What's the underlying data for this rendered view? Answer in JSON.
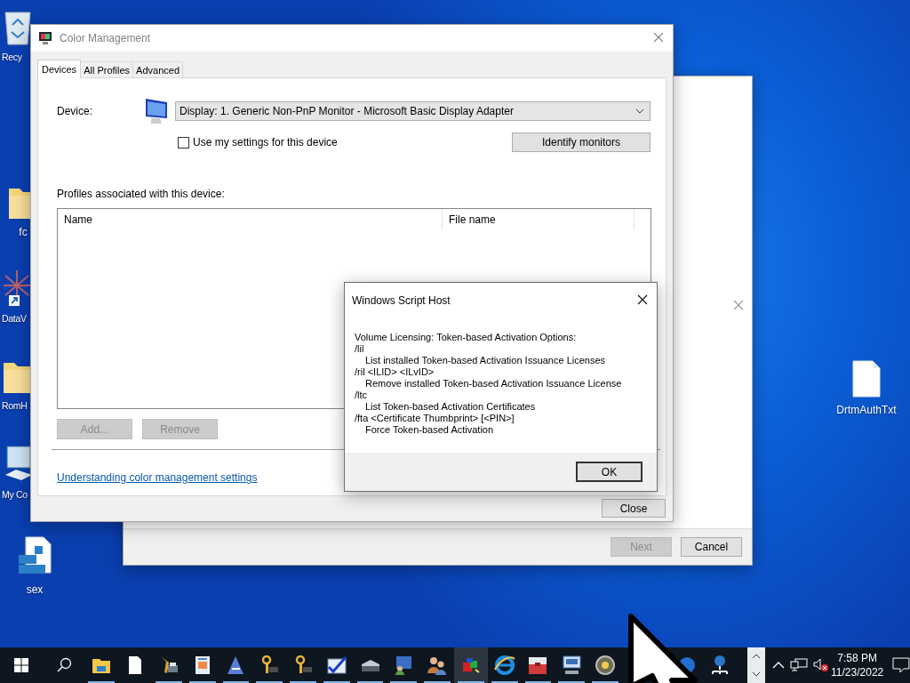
{
  "desktop_icons": [
    {
      "label": "Recy"
    },
    {
      "label": "fc"
    },
    {
      "label": "DataV"
    },
    {
      "label": "RomH"
    },
    {
      "label": "My Co"
    },
    {
      "label": "sex"
    },
    {
      "label": "DrtmAuthTxt"
    }
  ],
  "wizard_window": {
    "next_button": {
      "label": "Next",
      "disabled": true
    },
    "cancel_button": {
      "label": "Cancel"
    }
  },
  "color_management": {
    "window": {
      "title": "Color Management"
    },
    "tabs": [
      {
        "label": "Devices",
        "selected": true
      },
      {
        "label": "All Profiles",
        "selected": false
      },
      {
        "label": "Advanced",
        "selected": false
      }
    ],
    "device_label": "Device:",
    "device_value": "Display: 1. Generic Non-PnP Monitor - Microsoft Basic Display Adapter",
    "use_my_settings": {
      "label": "Use my settings for this device",
      "checked": false
    },
    "identify_button": "Identify monitors",
    "profiles_label": "Profiles associated with this device:",
    "table": {
      "columns": [
        "Name",
        "File name"
      ]
    },
    "add_button": {
      "label": "Add...",
      "disabled": true
    },
    "remove_button": {
      "label": "Remove",
      "disabled": true
    },
    "help_link": "Understanding color management settings",
    "close_button": "Close"
  },
  "script_host": {
    "window": {
      "title": "Windows Script Host"
    },
    "heading": "Volume Licensing: Token-based Activation Options:",
    "options": [
      {
        "switch": "/lil",
        "description": "List installed Token-based Activation Issuance Licenses"
      },
      {
        "switch": "/ril <ILID> <ILvID>",
        "description": "Remove installed Token-based Activation Issuance License"
      },
      {
        "switch": "/ltc",
        "description": "List Token-based Activation Certificates"
      },
      {
        "switch": "/fta <Certificate Thumbprint> [<PIN>]",
        "description": "Force Token-based Activation"
      }
    ],
    "ok_button": "OK"
  },
  "taskbar": {
    "apps": [
      {
        "running": true,
        "selected": false
      },
      {
        "running": false,
        "selected": false
      },
      {
        "running": true,
        "selected": false
      },
      {
        "running": true,
        "selected": false
      },
      {
        "running": true,
        "selected": false
      },
      {
        "running": true,
        "selected": false
      },
      {
        "running": true,
        "selected": false
      },
      {
        "running": true,
        "selected": false
      },
      {
        "running": true,
        "selected": false
      },
      {
        "running": true,
        "selected": false
      },
      {
        "running": true,
        "selected": false
      },
      {
        "running": true,
        "selected": true
      },
      {
        "running": true,
        "selected": false
      },
      {
        "running": true,
        "selected": false
      },
      {
        "running": true,
        "selected": false
      },
      {
        "running": true,
        "selected": false
      },
      {
        "running": false,
        "selected": false
      },
      {
        "running": false,
        "selected": false
      }
    ],
    "clock": {
      "time": "7:58 PM",
      "date": "11/23/2022"
    }
  }
}
